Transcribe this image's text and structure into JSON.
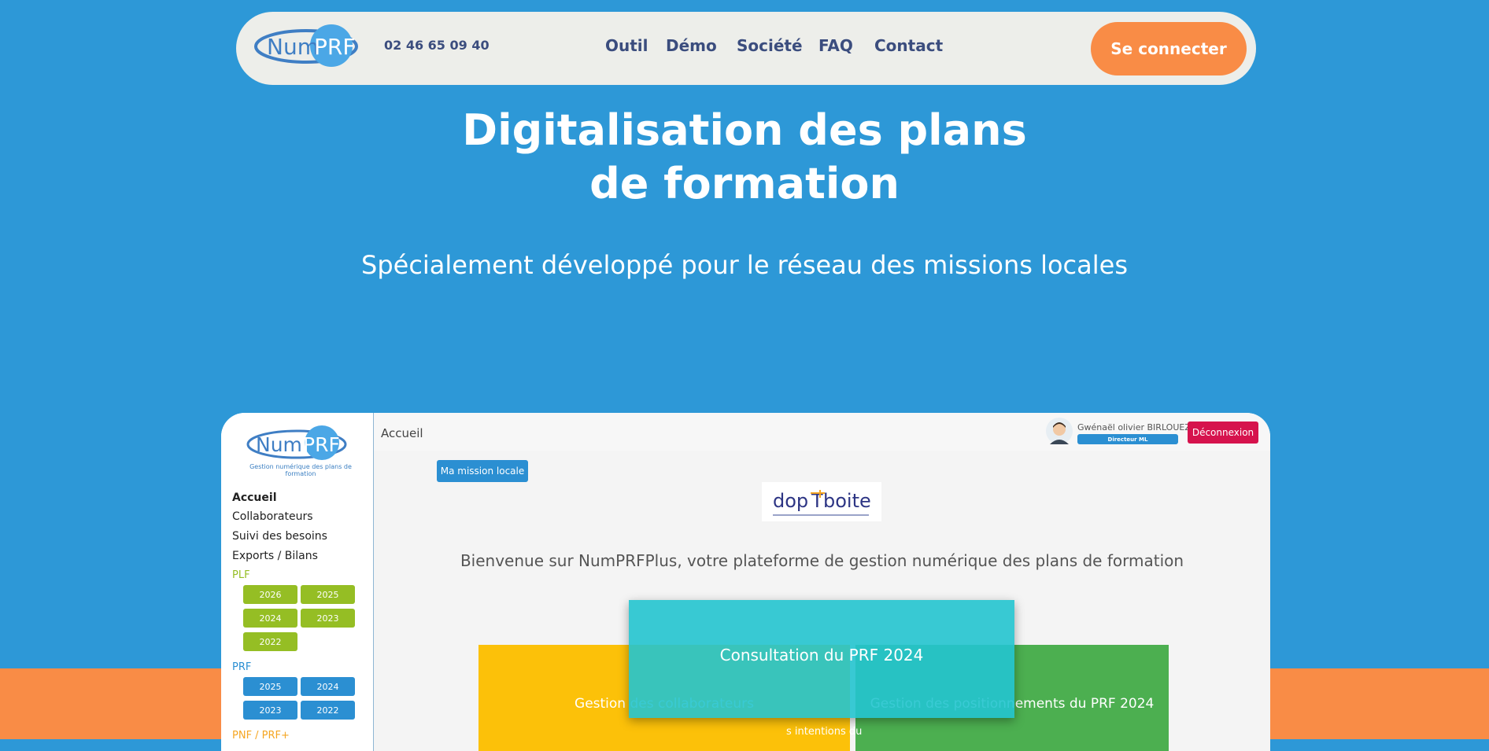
{
  "header": {
    "logo_text": "NumPRF",
    "phone": "02 46 65 09 40",
    "nav": [
      "Outil",
      "Démo",
      "Société",
      "FAQ",
      "Contact"
    ],
    "login_label": "Se connecter"
  },
  "hero": {
    "title_line1": "Digitalisation des plans",
    "title_line2": "de formation",
    "subtitle": "Spécialement développé pour le réseau des missions locales"
  },
  "app": {
    "logo_text": "NumPRF",
    "logo_subtitle": "Gestion numérique des plans de formation",
    "breadcrumb": "Accueil",
    "user": {
      "name": "Gwénaël olivier BIRLOUEZ",
      "role": "Directeur ML"
    },
    "logout_label": "Déconnexion",
    "mission_button": "Ma mission locale",
    "partner_logo": "dopTaboite",
    "welcome": "Bienvenue sur NumPRFPlus, votre plateforme de gestion numérique des plans de formation",
    "menu": [
      "Accueil",
      "Collaborateurs",
      "Suivi des besoins",
      "Exports / Bilans"
    ],
    "plf": {
      "label": "PLF",
      "years": [
        "2026",
        "2025",
        "2024",
        "2023",
        "2022"
      ]
    },
    "prf": {
      "label": "PRF",
      "years": [
        "2025",
        "2024",
        "2023",
        "2022"
      ]
    },
    "pnf_label": "PNF / PRF+",
    "cards": {
      "yellow": "Gestion des collaborateurs",
      "green": "Gestion des positionnements du PRF 2024",
      "teal": "Consultation du PRF 2024",
      "partial": "s intentions du"
    }
  },
  "colors": {
    "background": "#2d98d7",
    "accent_orange": "#f98c46",
    "nav_text": "#3b4d7e",
    "plf_green": "#95be24",
    "prf_blue": "#2b8fd2",
    "logout_red": "#d6134d",
    "card_yellow": "#fcc109",
    "card_green": "#4caf50",
    "card_teal": "#24c4cf"
  }
}
